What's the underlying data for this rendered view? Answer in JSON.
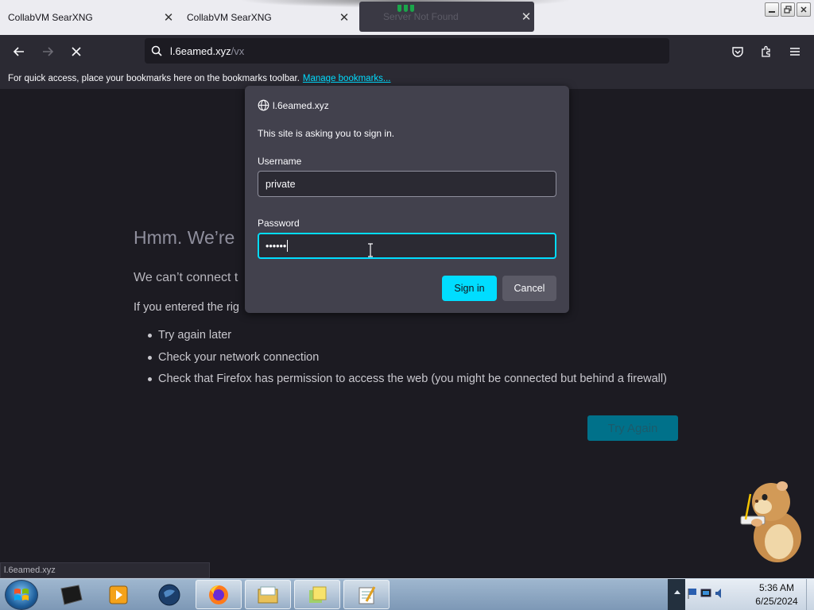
{
  "browser": {
    "tabs": [
      {
        "title": "CollabVM SearXNG"
      },
      {
        "title": "CollabVM SearXNG"
      },
      {
        "title": "Server Not Found"
      }
    ],
    "url": {
      "host": "l.6eamed.xyz",
      "path": "/vx"
    },
    "bookmarks_bar": {
      "message": "For quick access, place your bookmarks here on the bookmarks toolbar.",
      "link": "Manage bookmarks..."
    }
  },
  "error_page": {
    "title": "Hmm. We’re",
    "line1": "We can’t connect t",
    "line2": "If you entered the rig",
    "suggestions": [
      "Try again later",
      "Check your network connection",
      "Check that Firefox has permission to access the web (you might be connected but behind a firewall)"
    ],
    "try_again": "Try Again"
  },
  "auth_dialog": {
    "host": "l.6eamed.xyz",
    "message": "This site is asking you to sign in.",
    "username_label": "Username",
    "username_value": "private",
    "password_label": "Password",
    "password_value": "••••••",
    "sign_in": "Sign in",
    "cancel": "Cancel"
  },
  "status": {
    "text": "l.6eamed.xyz"
  },
  "taskbar": {
    "clock_time": "5:36 AM",
    "clock_date": "6/25/2024"
  },
  "colors": {
    "accent": "#00ddff",
    "page_bg": "#1c1b22",
    "dialog_bg": "#42414d"
  }
}
